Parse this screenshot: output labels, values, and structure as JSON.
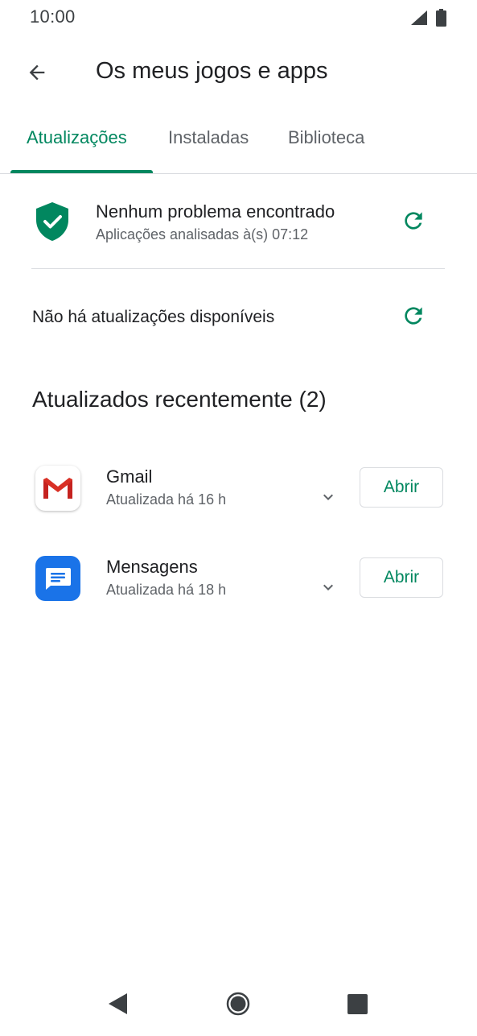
{
  "status_bar": {
    "time": "10:00"
  },
  "app_bar": {
    "title": "Os meus jogos e apps"
  },
  "tabs": [
    {
      "label": "Atualizações",
      "active": true
    },
    {
      "label": "Instaladas",
      "active": false
    },
    {
      "label": "Biblioteca",
      "active": false
    }
  ],
  "play_protect": {
    "title": "Nenhum problema encontrado",
    "subtitle": "Aplicações analisadas à(s) 07:12"
  },
  "updates": {
    "message": "Não há atualizações disponíveis"
  },
  "recent": {
    "title": "Atualizados recentemente (2)",
    "apps": [
      {
        "name": "Gmail",
        "updated": "Atualizada há 16 h",
        "button": "Abrir",
        "icon": "gmail-icon"
      },
      {
        "name": "Mensagens",
        "updated": "Atualizada há 18 h",
        "button": "Abrir",
        "icon": "messages-icon"
      }
    ]
  },
  "colors": {
    "accent": "#01875f",
    "text_primary": "#202124",
    "text_secondary": "#5f6368",
    "divider": "#dadce0",
    "messages_blue": "#1a73e8"
  }
}
